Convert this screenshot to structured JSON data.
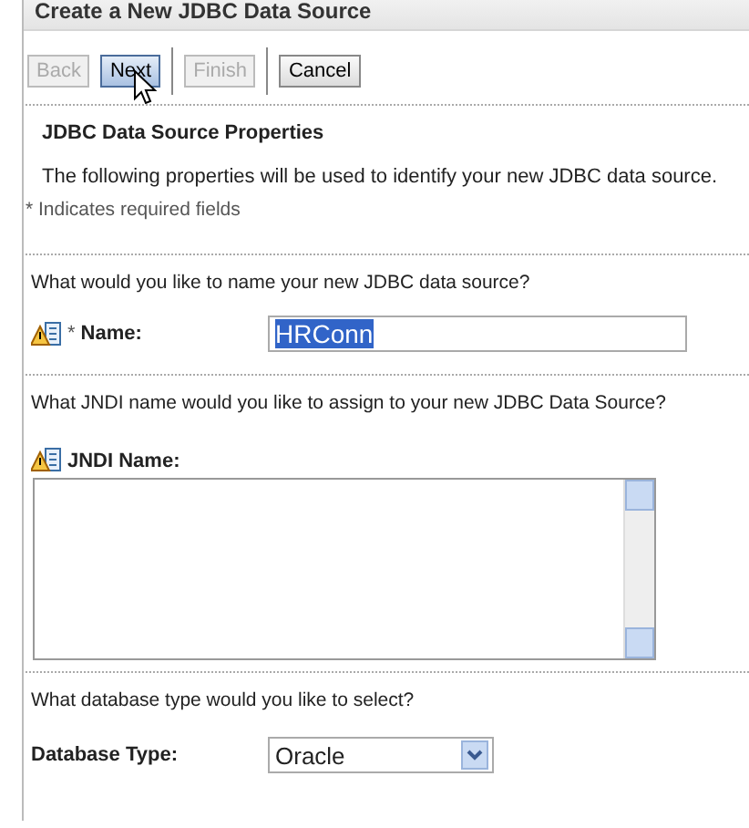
{
  "panel": {
    "title": "Create a New JDBC Data Source"
  },
  "buttons": [
    {
      "label": "Back",
      "disabled": true,
      "hovered": false
    },
    {
      "label": "Next",
      "disabled": false,
      "hovered": true
    },
    {
      "label": "Finish",
      "disabled": true,
      "hovered": false
    },
    {
      "label": "Cancel",
      "disabled": false,
      "hovered": false
    }
  ],
  "section": {
    "heading": "JDBC Data Source Properties",
    "description": "The following properties will be used to identify your new JDBC data source.",
    "required_note": "* Indicates required fields"
  },
  "questions": [
    {
      "kind": "text",
      "question": "What would you like to name your new JDBC data source?",
      "label": "Name:",
      "required_mark": "*",
      "value": "HRConn",
      "value_selected": true
    },
    {
      "kind": "textarea",
      "question": "What JNDI name would you like to assign to your new JDBC Data Source?",
      "label": "JNDI Name:"
    },
    {
      "kind": "select",
      "question": "What database type would you like to select?",
      "label": "Database Type:",
      "value": "Oracle"
    }
  ]
}
